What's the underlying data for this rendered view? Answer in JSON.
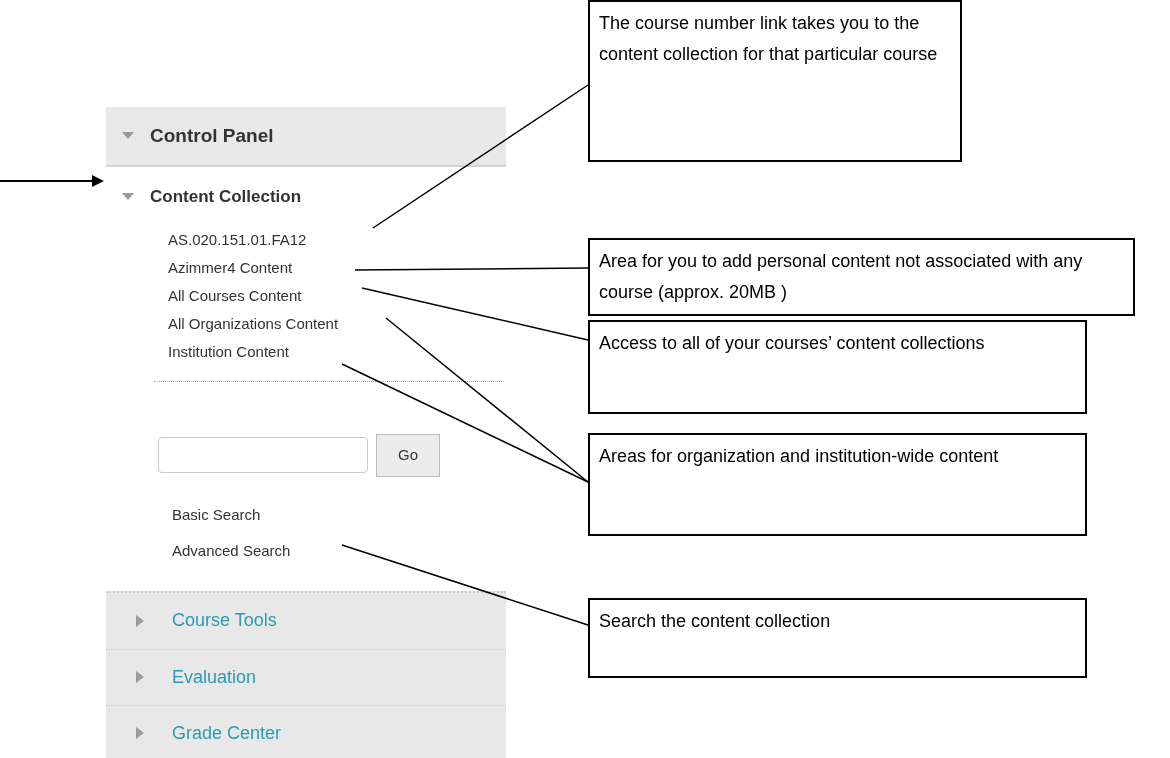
{
  "panel": {
    "title": "Control Panel",
    "expanded": true
  },
  "content_collection": {
    "title": "Content Collection",
    "expanded": true,
    "links": [
      "AS.020.151.01.FA12",
      "Azimmer4 Content",
      "All Courses Content",
      "All Organizations Content",
      "Institution Content"
    ],
    "search": {
      "button": "Go"
    },
    "search_links": [
      "Basic Search",
      "Advanced Search"
    ]
  },
  "sections": [
    {
      "title": "Course Tools",
      "expanded": false
    },
    {
      "title": "Evaluation",
      "expanded": false
    },
    {
      "title": "Grade Center",
      "expanded": false
    }
  ],
  "callouts": [
    "The course number link takes you to the content collection for that particular course",
    "Area for you to add personal content not associated with any course (approx. 20MB )",
    "Access to all of your courses’ content collections",
    "Areas for organization and institution-wide content",
    "Search the content collection"
  ]
}
